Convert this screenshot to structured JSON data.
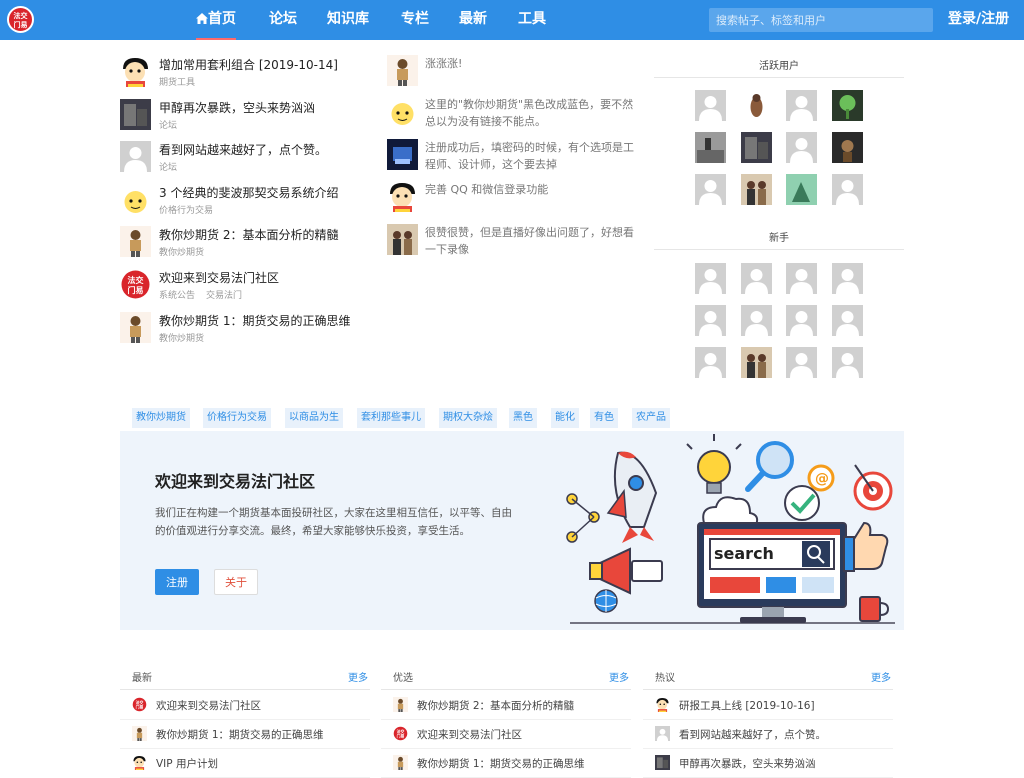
{
  "header": {
    "logo_text": "法交\n门易",
    "nav": [
      {
        "label": "首页",
        "icon": "home-icon",
        "active": true
      },
      {
        "label": "论坛"
      },
      {
        "label": "知识库"
      },
      {
        "label": "专栏"
      },
      {
        "label": "最新"
      },
      {
        "label": "工具"
      }
    ],
    "search_placeholder": "搜索帖子、标签和用户",
    "login_label": "登录/注册",
    "brand_color": "#2f8ee5"
  },
  "feed": [
    {
      "title": "增加常用套利组合 [2019-10-14]",
      "meta": [
        "期货工具"
      ],
      "avatar": "cartoon-boy"
    },
    {
      "title": "甲醇再次暴跌，空头来势汹汹",
      "meta": [
        "论坛"
      ],
      "avatar": "photo-dark"
    },
    {
      "title": "看到网站越来越好了，点个赞。",
      "meta": [
        "论坛"
      ],
      "avatar": "default"
    },
    {
      "title": "3 个经典的斐波那契交易系统介绍",
      "meta": [
        "价格行为交易"
      ],
      "avatar": "cartoon-face"
    },
    {
      "title": "教你炒期货 2：基本面分析的精髓",
      "meta": [
        "教你炒期货"
      ],
      "avatar": "figure"
    },
    {
      "title": "欢迎来到交易法门社区",
      "meta": [
        "系统公告",
        "交易法门"
      ],
      "avatar": "logo"
    },
    {
      "title": "教你炒期货 1：期货交易的正确思维",
      "meta": [
        "教你炒期货"
      ],
      "avatar": "figure"
    }
  ],
  "activity": [
    {
      "text": "涨涨涨!",
      "avatar": "figure"
    },
    {
      "text": "这里的\"教你炒期货\"黑色改成蓝色，要不然总以为没有链接不能点。",
      "avatar": "cartoon-face"
    },
    {
      "text": "注册成功后，填密码的时候，有个选项是工程师、设计师，这个要去掉",
      "avatar": "photo-blue"
    },
    {
      "text": "完善 QQ 和微信登录功能",
      "avatar": "cartoon-boy"
    },
    {
      "text": "很赞很赞，但是直播好像出问题了，好想看一下录像",
      "avatar": "photo-people"
    }
  ],
  "sidebar": {
    "active_title": "活跃用户",
    "active_users": [
      "default",
      "bird",
      "default",
      "plant",
      "photo-gray",
      "photo-dark",
      "default",
      "photo-brown",
      "default",
      "photo-people",
      "photo-green",
      "default"
    ],
    "new_title": "新手",
    "new_users": [
      "default",
      "default",
      "default",
      "default",
      "default",
      "default",
      "default",
      "default",
      "default",
      "photo-people",
      "default",
      "default"
    ]
  },
  "tags": [
    "教你炒期货",
    "价格行为交易",
    "以商品为生",
    "套利那些事儿",
    "期权大杂烩",
    "黑色",
    "能化",
    "有色",
    "农产品"
  ],
  "banner": {
    "title": "欢迎来到交易法门社区",
    "description": "我们正在构建一个期货基本面投研社区，大家在这里相互信任，以平等、自由的价值观进行分享交流。最终，希望大家能够快乐投资，享受生活。",
    "register_label": "注册",
    "about_label": "关于",
    "illustration_word": "search"
  },
  "columns": [
    {
      "title": "最新",
      "more": "更多",
      "items": [
        {
          "text": "欢迎来到交易法门社区",
          "avatar": "logo"
        },
        {
          "text": "教你炒期货 1：期货交易的正确思维",
          "avatar": "figure"
        },
        {
          "text": "VIP 用户计划",
          "avatar": "cartoon-boy"
        }
      ]
    },
    {
      "title": "优选",
      "more": "更多",
      "items": [
        {
          "text": "教你炒期货 2：基本面分析的精髓",
          "avatar": "figure"
        },
        {
          "text": "欢迎来到交易法门社区",
          "avatar": "logo"
        },
        {
          "text": "教你炒期货 1：期货交易的正确思维",
          "avatar": "figure"
        }
      ]
    },
    {
      "title": "热议",
      "more": "更多",
      "items": [
        {
          "text": "研报工具上线 [2019-10-16]",
          "avatar": "cartoon-boy"
        },
        {
          "text": "看到网站越来越好了，点个赞。",
          "avatar": "default"
        },
        {
          "text": "甲醇再次暴跌，空头来势汹汹",
          "avatar": "photo-dark"
        }
      ]
    }
  ]
}
